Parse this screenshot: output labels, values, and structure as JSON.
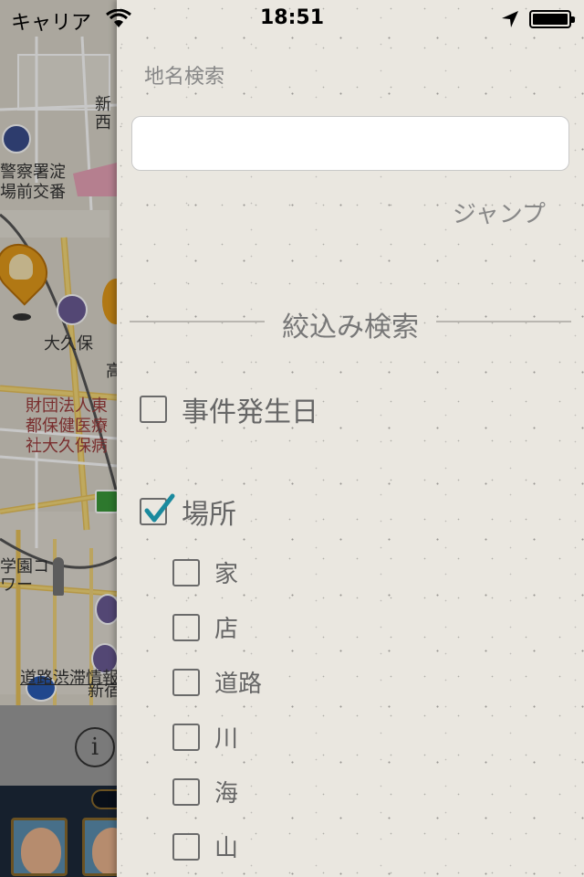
{
  "status_bar": {
    "carrier": "キャリア",
    "time": "18:51"
  },
  "map": {
    "labels": {
      "police": "警察署淀",
      "police2": "場前交番",
      "station": "大久保",
      "hospital1": "財団法人東",
      "hospital2": "都保健医療",
      "hospital3": "社大久保病",
      "school1": "学園コ",
      "school2": "ワー",
      "traffic": "道路渋滞情報",
      "shinjuku": "新宿",
      "nishi": "西",
      "shin": "新",
      "taka": "高"
    },
    "info_label": "i"
  },
  "panel": {
    "place_search_label": "地名検索",
    "search_value": "",
    "jump_label": "ジャンプ",
    "filter_title": "絞込み検索",
    "filters": [
      {
        "label": "事件発生日",
        "checked": false
      },
      {
        "label": "場所",
        "checked": true
      }
    ],
    "places": [
      {
        "label": "家",
        "checked": false
      },
      {
        "label": "店",
        "checked": false
      },
      {
        "label": "道路",
        "checked": false
      },
      {
        "label": "川",
        "checked": false
      },
      {
        "label": "海",
        "checked": false
      },
      {
        "label": "山",
        "checked": false
      }
    ]
  },
  "colors": {
    "accent_check": "#1a8a9e",
    "map_pin": "#e39a1a"
  }
}
